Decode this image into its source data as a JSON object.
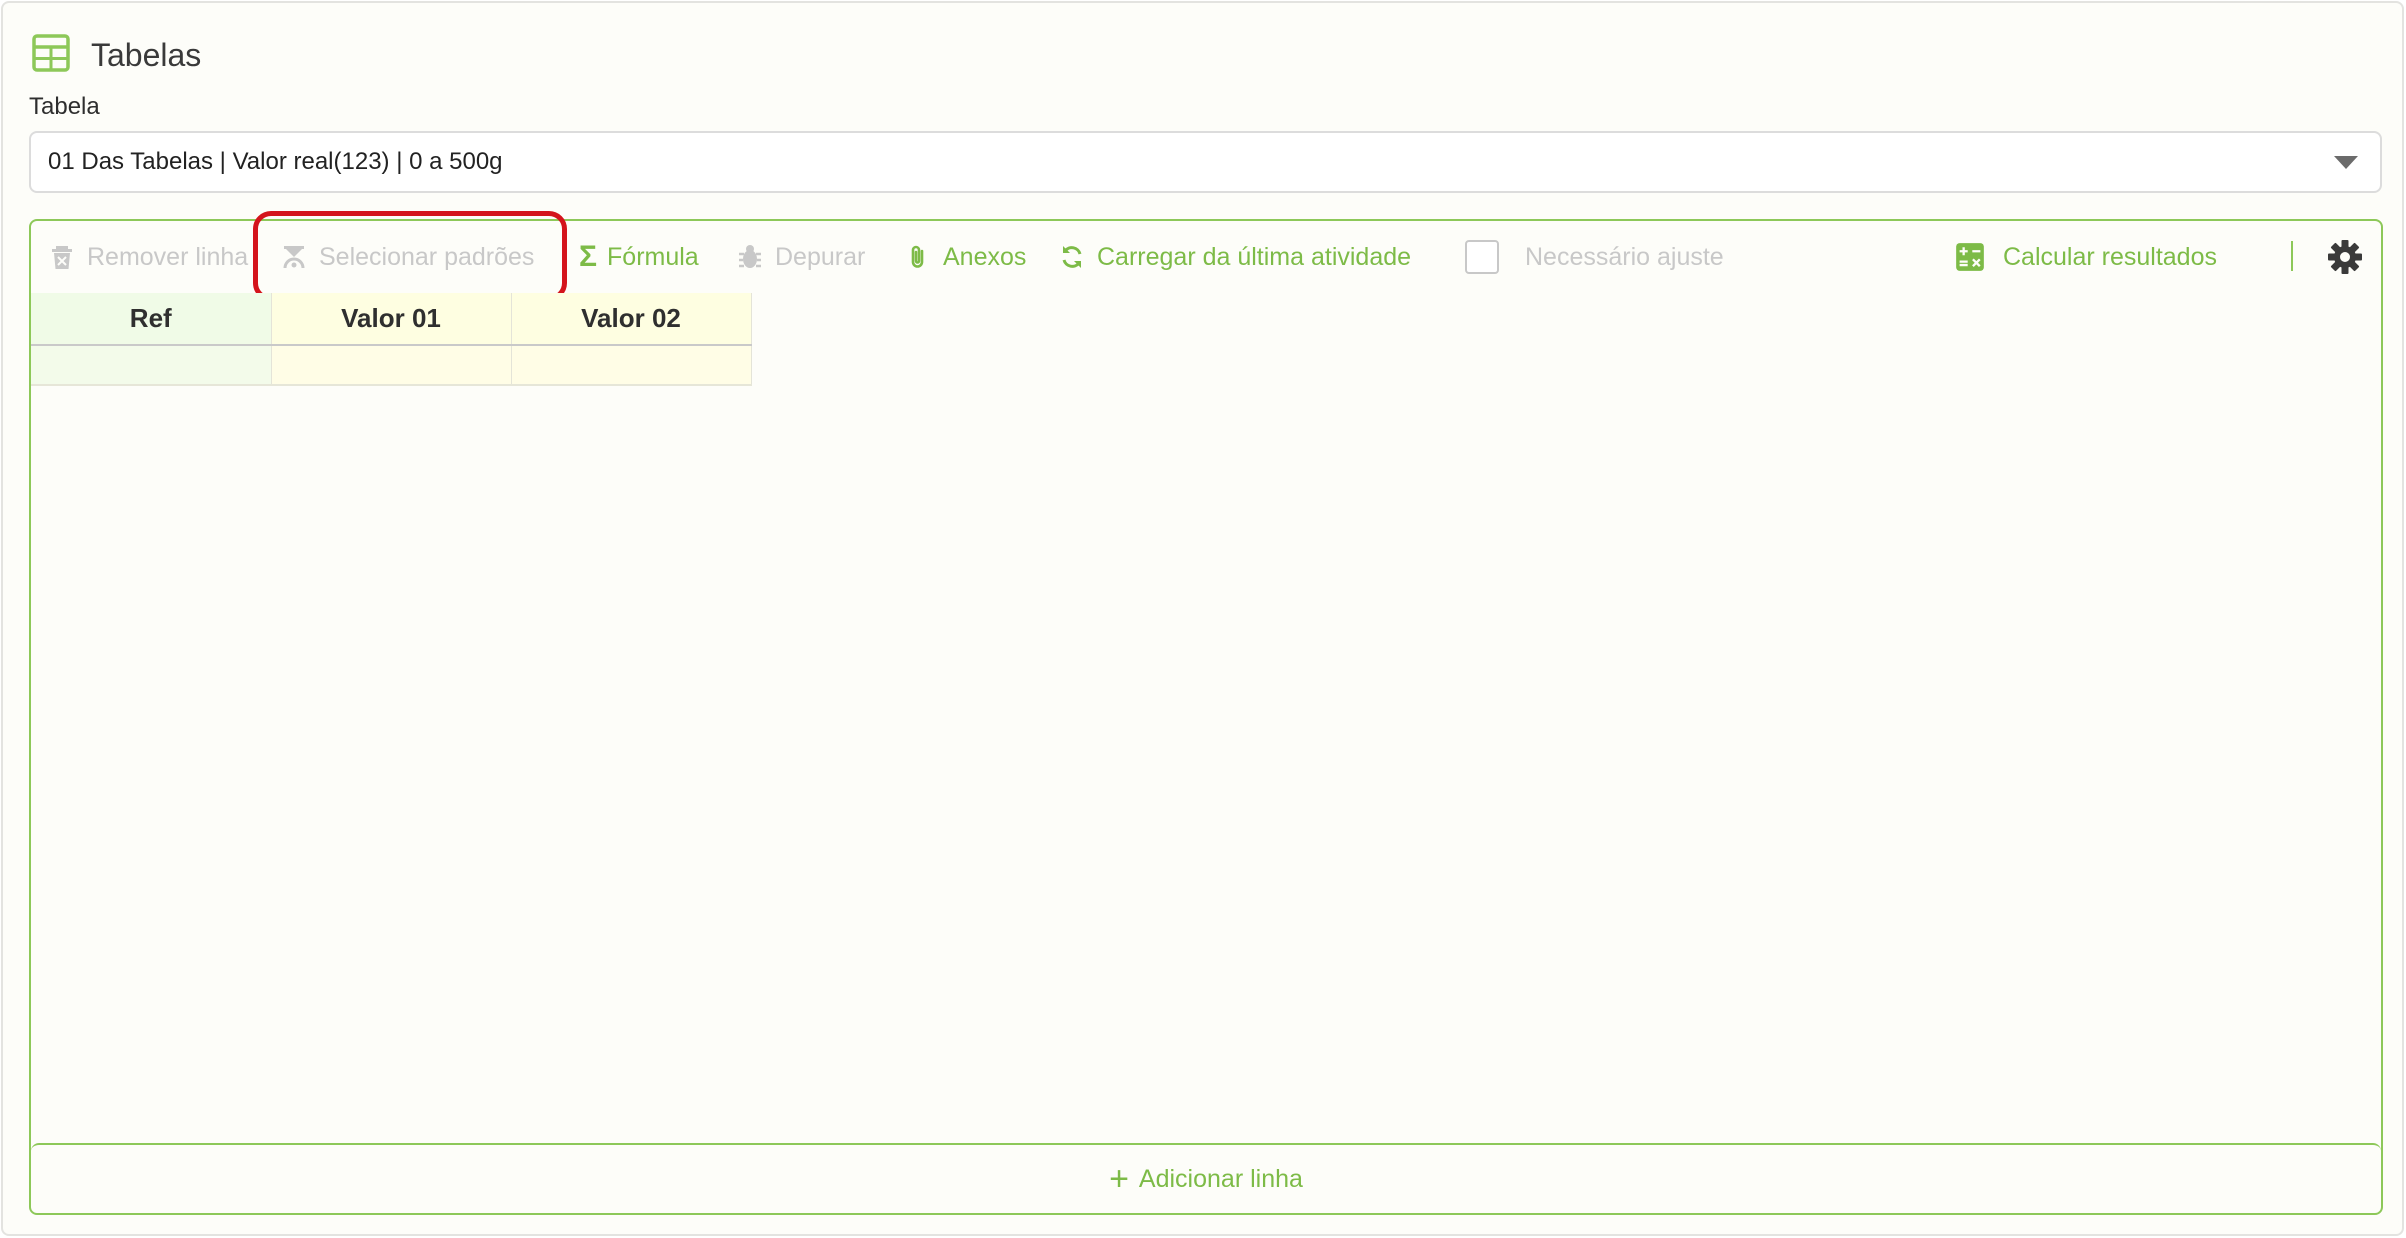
{
  "header": {
    "title": "Tabelas",
    "icon": "table-icon"
  },
  "form": {
    "table_label": "Tabela",
    "table_selected": "01 Das Tabelas | Valor real(123) | 0 a 500g"
  },
  "toolbar": {
    "remove_row": "Remover linha",
    "select_standards": "Selecionar padrões",
    "formula": "Fórmula",
    "debug": "Depurar",
    "attachments": "Anexos",
    "load_last": "Carregar da última atividade",
    "adjust_needed": "Necessário ajuste",
    "calculate": "Calcular resultados"
  },
  "grid": {
    "columns": [
      "Ref",
      "Valor 01",
      "Valor 02"
    ],
    "rows": [
      [
        "",
        "",
        ""
      ]
    ]
  },
  "footer": {
    "add_row": "Adicionar linha"
  },
  "colors": {
    "accent": "#7dbb47",
    "disabled": "#c8c8c8",
    "highlight": "#d4141c"
  }
}
